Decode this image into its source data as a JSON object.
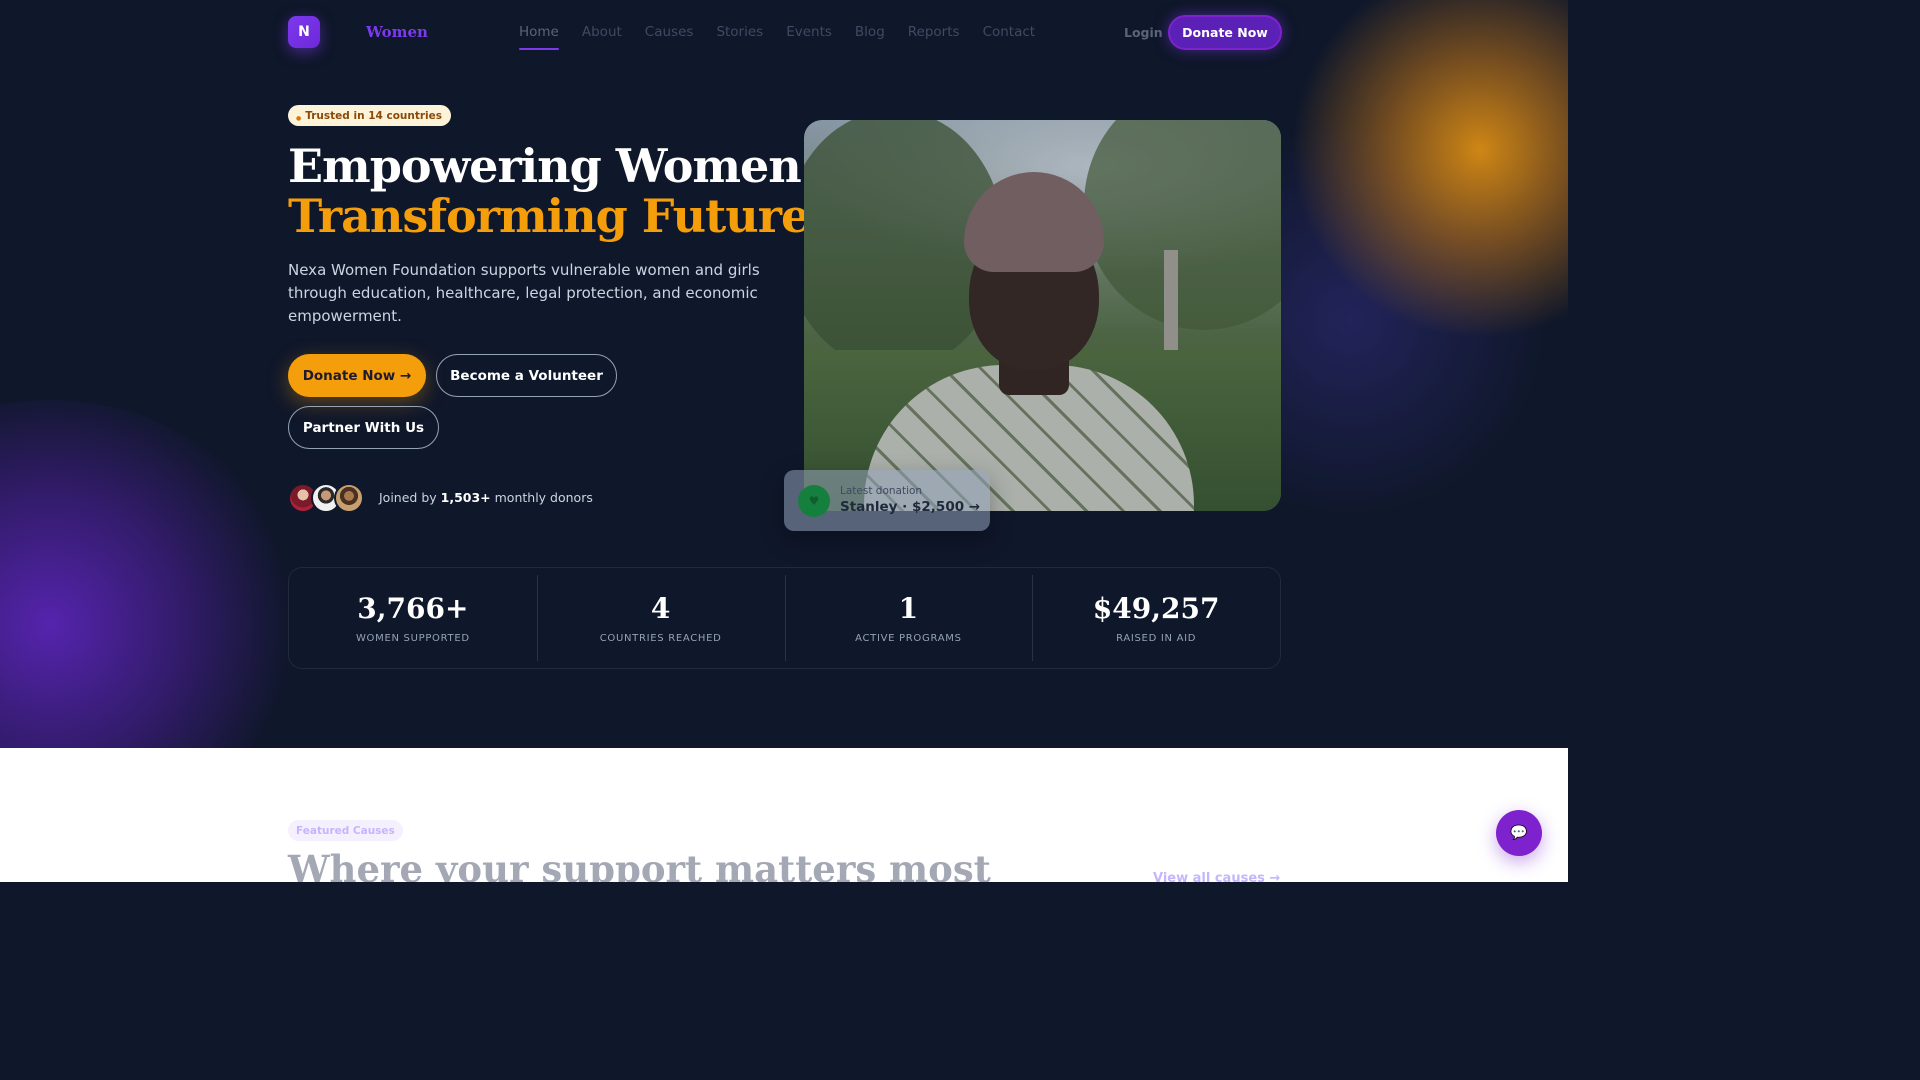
{
  "brand": {
    "logo_letter": "N",
    "name": "Women",
    "accent": "#7c3aed"
  },
  "nav": {
    "items": [
      "Home",
      "About",
      "Causes",
      "Stories",
      "Events",
      "Blog",
      "Reports",
      "Contact"
    ],
    "active": "Home",
    "login": "Login",
    "donate": "Donate Now"
  },
  "hero": {
    "badge": "Trusted in 14 countries",
    "title_line1": "Empowering Women.",
    "title_line2": "Transforming Futures.",
    "description": "Nexa Women Foundation supports vulnerable women and girls through education, healthcare, legal protection, and economic empowerment.",
    "buttons": {
      "donate": "Donate Now →",
      "volunteer": "Become a Volunteer",
      "partner": "Partner With Us"
    },
    "joined_prefix": "Joined by ",
    "joined_count": "1,503+",
    "joined_suffix": " monthly donors",
    "latest_label": "Latest donation",
    "latest_value": "Stanley · $2,500 →",
    "colors": {
      "primary": "#f59e0b",
      "background": "#0f172a"
    }
  },
  "stats": [
    {
      "value": "3,766+",
      "label": "WOMEN SUPPORTED"
    },
    {
      "value": "4",
      "label": "COUNTRIES REACHED"
    },
    {
      "value": "1",
      "label": "ACTIVE PROGRAMS"
    },
    {
      "value": "$49,257",
      "label": "RAISED IN AID"
    }
  ],
  "featured": {
    "tag": "Featured Causes",
    "title": "Where your support matters most",
    "view_all": "View all causes →"
  },
  "icons": {
    "chat": "chat-icon",
    "donation": "heart-icon"
  }
}
